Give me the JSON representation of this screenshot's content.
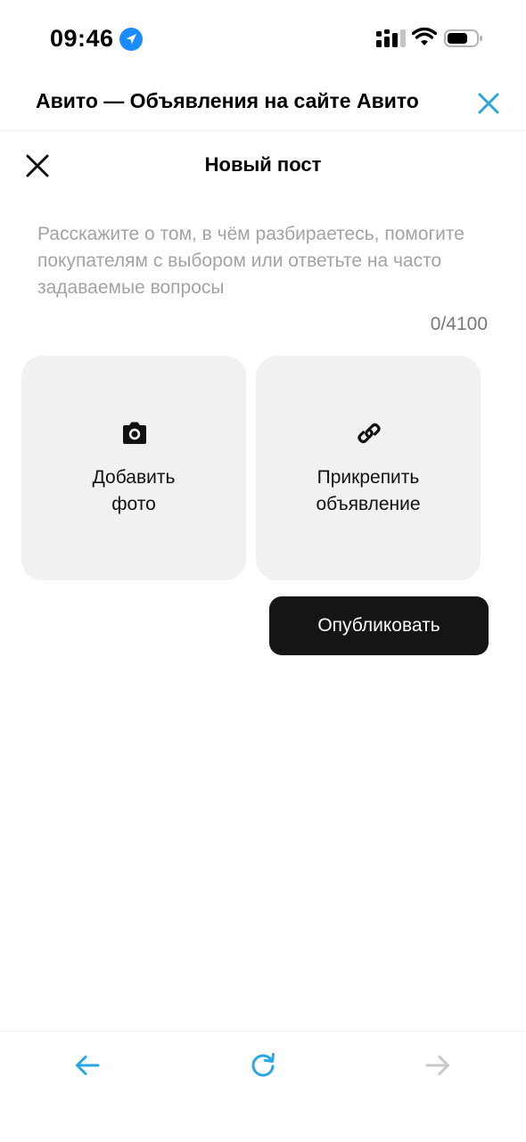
{
  "status_bar": {
    "time": "09:46",
    "location_icon": "location-arrow-icon",
    "signal_icon": "cellular-signal-icon",
    "wifi_icon": "wifi-icon",
    "battery_icon": "battery-icon",
    "location_color": "#1a8cff"
  },
  "browser": {
    "title": "Авито — Объявления на сайте Авито",
    "close_icon": "close-icon",
    "accent_color": "#2aa7e3"
  },
  "post": {
    "title": "Новый пост",
    "close_icon": "close-icon",
    "placeholder": "Расскажите о том, в чём разбираетесь, помогите покупателям с выбором или ответьте на часто задаваемые вопросы",
    "value": "",
    "counter": "0/4100",
    "tiles": [
      {
        "label": "Добавить\nфото",
        "icon": "camera-icon"
      },
      {
        "label": "Прикрепить\nобъявление",
        "icon": "link-icon"
      }
    ],
    "publish_label": "Опубликовать"
  },
  "bottom_nav": {
    "back_icon": "arrow-left-icon",
    "reload_icon": "reload-icon",
    "forward_icon": "arrow-right-icon",
    "active_color": "#2aa7e3",
    "disabled_color": "#c8c8c8"
  }
}
